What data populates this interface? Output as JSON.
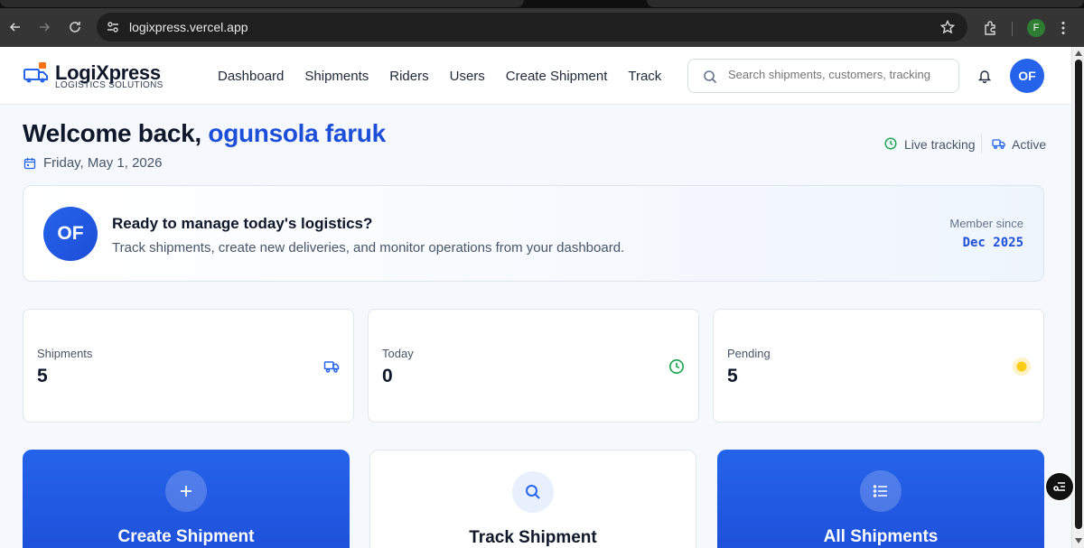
{
  "browser": {
    "url": "logixpress.vercel.app",
    "profile_initial": "F"
  },
  "brand": {
    "title": "LogiXpress",
    "subtitle": "LOGISTICS SOLUTIONS",
    "accent_color": "#2563eb",
    "logo_icon": "truck-logo-icon"
  },
  "nav": {
    "items": [
      {
        "label": "Dashboard"
      },
      {
        "label": "Shipments"
      },
      {
        "label": "Riders"
      },
      {
        "label": "Users"
      },
      {
        "label": "Create Shipment"
      },
      {
        "label": "Track"
      }
    ]
  },
  "search": {
    "placeholder": "Search shipments, customers, tracking"
  },
  "user": {
    "initials": "OF"
  },
  "welcome": {
    "greeting": "Welcome back,",
    "name": "ogunsola faruk",
    "date": "Friday, May 1, 2026"
  },
  "status": {
    "live_label": "Live tracking",
    "active_label": "Active"
  },
  "banner": {
    "initials": "OF",
    "title": "Ready to manage today's logistics?",
    "subtitle": "Track shipments, create new deliveries, and monitor operations from your dashboard.",
    "member_label": "Member since",
    "member_value": "Dec 2025"
  },
  "stats": [
    {
      "label": "Shipments",
      "value": "5",
      "icon": "truck-icon",
      "color": "#2563eb"
    },
    {
      "label": "Today",
      "value": "0",
      "icon": "clock-icon",
      "color": "#16a34a"
    },
    {
      "label": "Pending",
      "value": "5",
      "icon": "dot-icon",
      "color": "#facc15"
    }
  ],
  "actions": [
    {
      "title": "Create Shipment",
      "icon": "plus-icon"
    },
    {
      "title": "Track Shipment",
      "icon": "search-icon"
    },
    {
      "title": "All Shipments",
      "icon": "list-icon"
    }
  ]
}
